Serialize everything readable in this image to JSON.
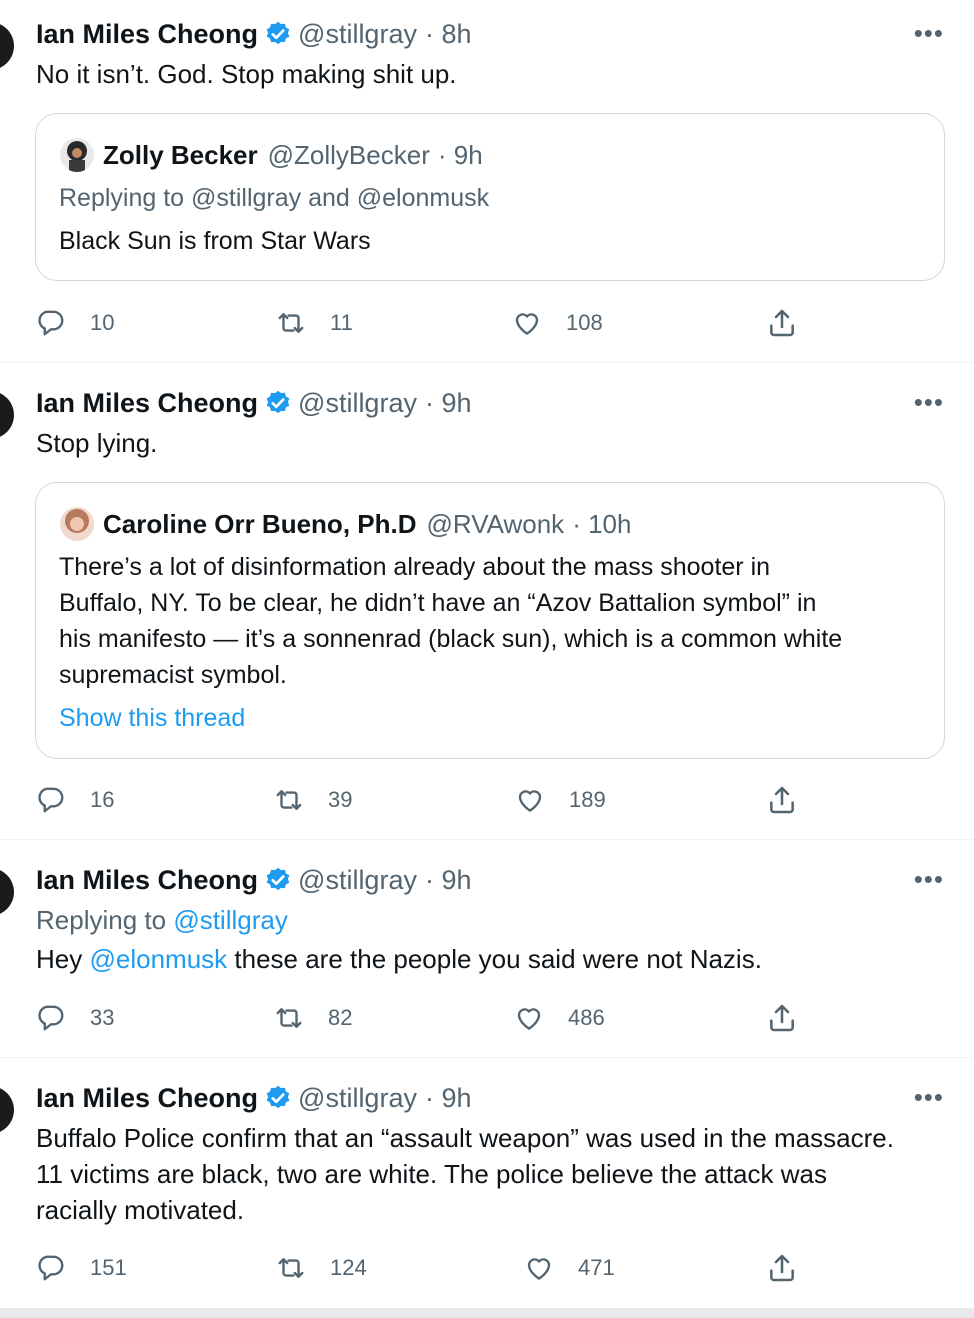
{
  "tweets": [
    {
      "author": "Ian Miles Cheong",
      "handle": "@stillgray",
      "time": "· 8h",
      "text": "No it isn’t. God. Stop making shit up.",
      "quote": {
        "author": "Zolly Becker",
        "handle": "@ZollyBecker",
        "time": "· 9h",
        "replying_prefix": "Replying to",
        "replying_to": "@stillgray and @elonmusk",
        "text": "Black Sun is from Star Wars"
      },
      "replies": "10",
      "retweets": "11",
      "likes": "108"
    },
    {
      "author": "Ian Miles Cheong",
      "handle": "@stillgray",
      "time": "· 9h",
      "text": "Stop lying.",
      "quote": {
        "author": "Caroline Orr Bueno, Ph.D",
        "handle": "@RVAwonk",
        "time": "· 10h",
        "lines": [
          "There’s a lot of disinformation already about the mass shooter in",
          "Buffalo, NY. To be clear, he didn’t have an “Azov Battalion symbol” in",
          "his manifesto — it’s a sonnenrad (black sun), which is a common white",
          "supremacist symbol."
        ],
        "show_thread": "Show this thread"
      },
      "replies": "16",
      "retweets": "39",
      "likes": "189"
    },
    {
      "author": "Ian Miles Cheong",
      "handle": "@stillgray",
      "time": "· 9h",
      "replying_prefix": "Replying to",
      "replying_to": "@stillgray",
      "text_before": "Hey",
      "mention": "@elonmusk",
      "text_after": "these are the people you said were not Nazis.",
      "replies": "33",
      "retweets": "82",
      "likes": "486"
    },
    {
      "author": "Ian Miles Cheong",
      "handle": "@stillgray",
      "time": "· 9h",
      "lines": [
        "Buffalo Police confirm that an “assault weapon” was used in the massacre.",
        "11 victims are black, two are white. The police believe the attack was",
        "racially motivated."
      ],
      "replies": "151",
      "retweets": "124",
      "likes": "471"
    }
  ],
  "more_label": "•••",
  "colors": {
    "accent": "#1d9bf0",
    "secondary_text": "#536471",
    "border": "#cfd9de"
  }
}
